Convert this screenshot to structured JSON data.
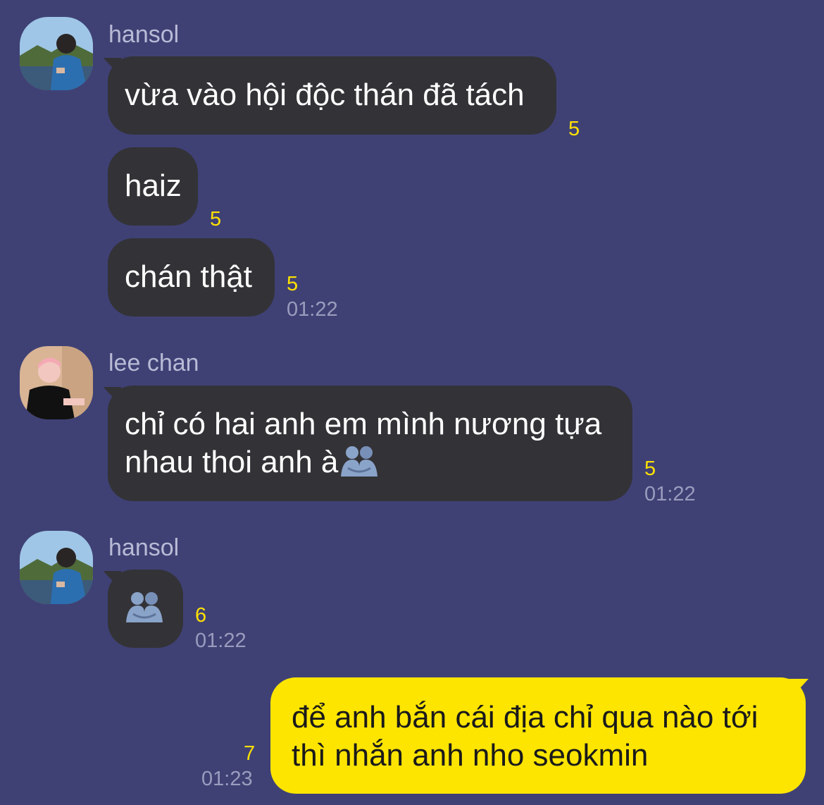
{
  "messages": [
    {
      "sender": "hansol",
      "text": "vừa vào hội độc thán đã tách",
      "unread": "5"
    },
    {
      "text": "haiz",
      "unread": "5"
    },
    {
      "text": "chán thật",
      "unread": "5",
      "time": "01:22"
    },
    {
      "sender": "lee chan",
      "line1": "chỉ có hai anh em mình nương tựa",
      "line2": "nhau thoi anh à",
      "emoji": "people-hugging-icon",
      "unread": "5",
      "time": "01:22"
    },
    {
      "sender": "hansol",
      "emoji": "people-hugging-icon",
      "unread": "6",
      "time": "01:22"
    },
    {
      "line1": "để anh bắn cái địa chỉ qua nào tới",
      "line2": "thì nhắn anh nho seokmin",
      "unread": "7",
      "time": "01:23"
    }
  ],
  "colors": {
    "background": "#3f4175",
    "bubble_other": "#333236",
    "bubble_me": "#fee500",
    "unread": "#ffe100",
    "meta": "#9a9cbd"
  }
}
